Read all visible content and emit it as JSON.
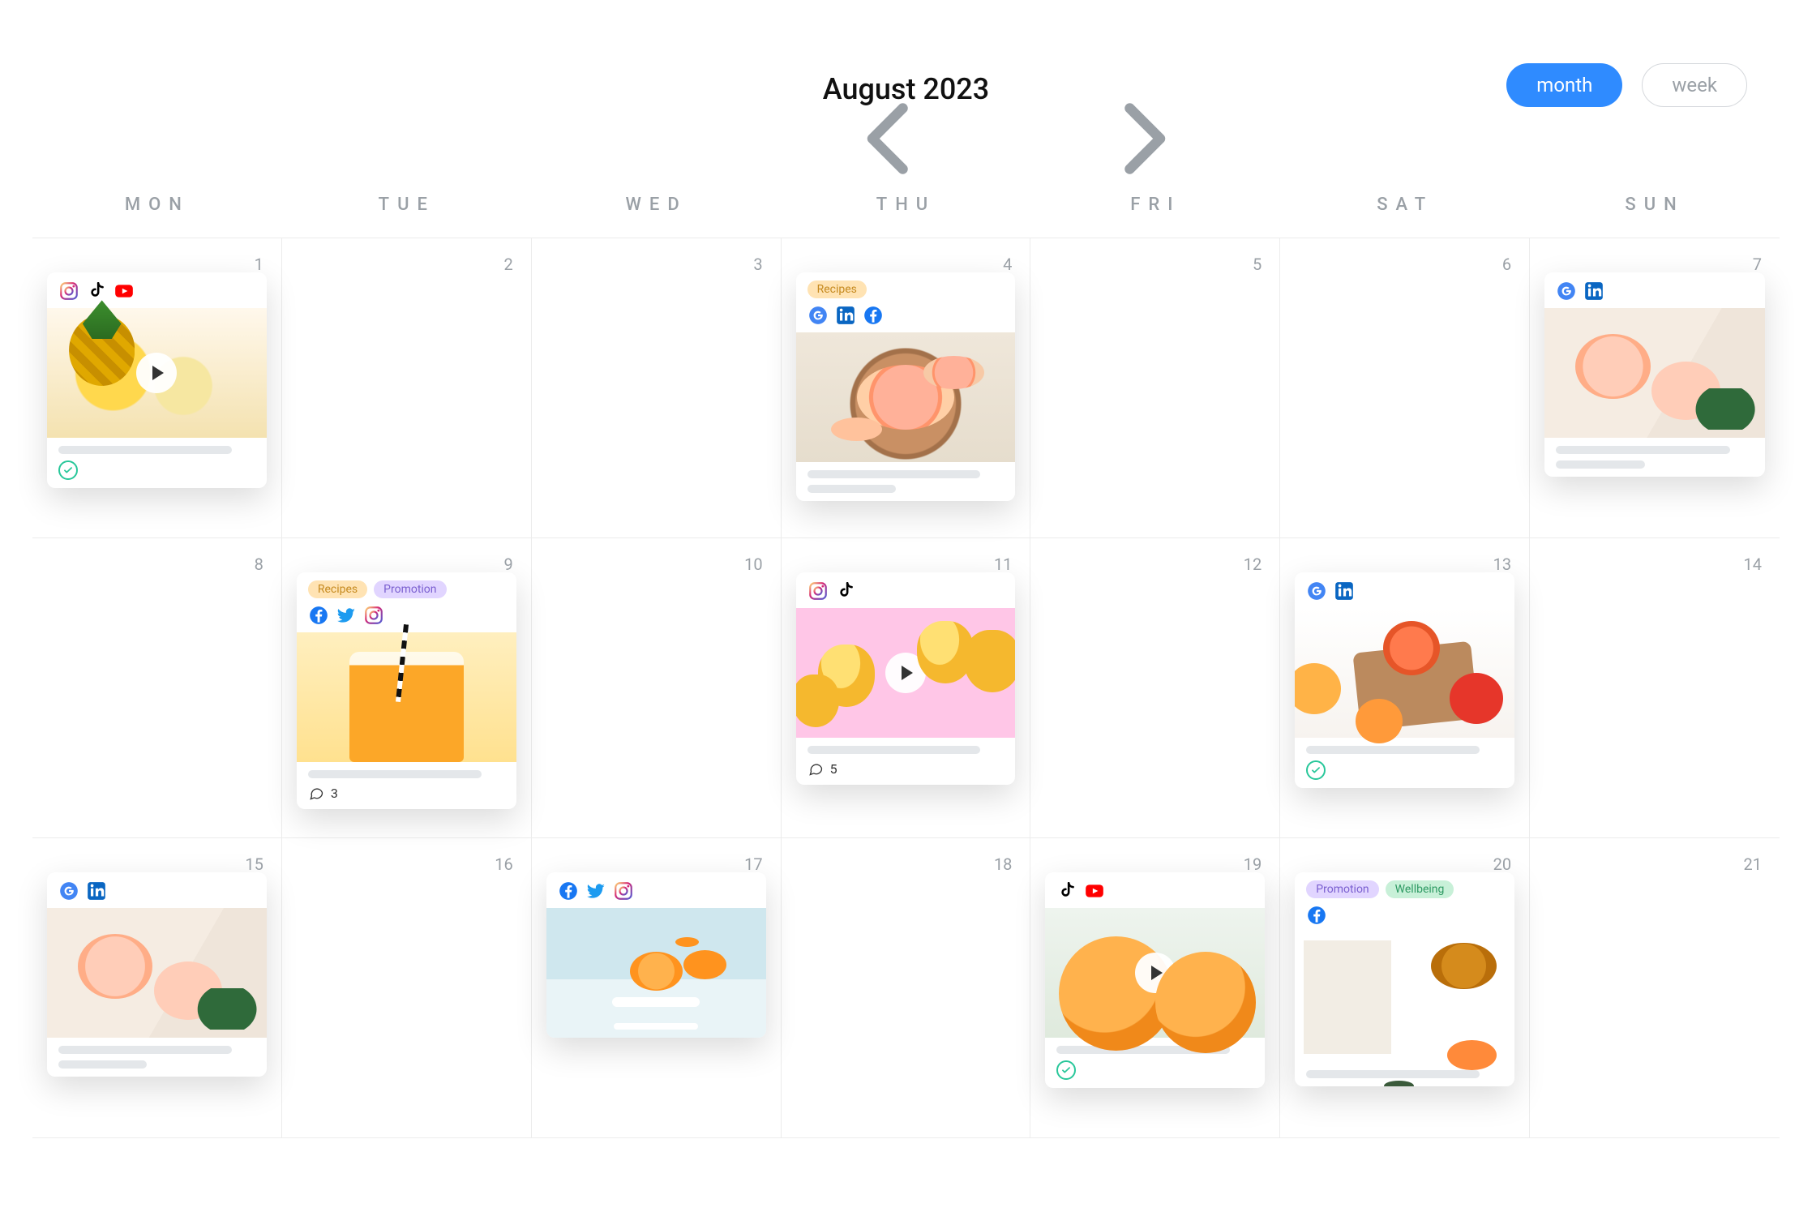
{
  "header": {
    "title": "August 2023",
    "prev_aria": "Previous month",
    "next_aria": "Next month"
  },
  "view_toggle": {
    "month": "month",
    "week": "week",
    "active": "month"
  },
  "weekdays": [
    "MON",
    "TUE",
    "WED",
    "THU",
    "FRI",
    "SAT",
    "SUN"
  ],
  "tag_labels": {
    "recipes": "Recipes",
    "promotion": "Promotion",
    "wellbeing": "Wellbeing"
  },
  "icon_names": {
    "instagram": "instagram-icon",
    "tiktok": "tiktok-icon",
    "youtube": "youtube-icon",
    "google": "google-icon",
    "linkedin": "linkedin-icon",
    "facebook": "facebook-icon",
    "twitter": "twitter-icon"
  },
  "days": [
    {
      "num": "1",
      "post": {
        "tags": [],
        "platforms": [
          "instagram",
          "tiktok",
          "youtube"
        ],
        "thumb": "pineapple",
        "has_play": true,
        "lines": [
          "long"
        ],
        "approved": true
      }
    },
    {
      "num": "2"
    },
    {
      "num": "3"
    },
    {
      "num": "4",
      "post": {
        "tags": [
          "recipes"
        ],
        "platforms": [
          "google",
          "linkedin",
          "facebook"
        ],
        "thumb": "grapefruit-wood",
        "lines": [
          "long",
          "short"
        ]
      }
    },
    {
      "num": "5"
    },
    {
      "num": "6"
    },
    {
      "num": "7",
      "post": {
        "tags": [],
        "platforms": [
          "google",
          "linkedin"
        ],
        "thumb": "cocktail-cloth",
        "lines": [
          "long",
          "short"
        ]
      }
    },
    {
      "num": "8"
    },
    {
      "num": "9",
      "post": {
        "tags": [
          "recipes",
          "promotion"
        ],
        "platforms": [
          "facebook",
          "twitter",
          "instagram"
        ],
        "thumb": "smoothie",
        "lines": [
          "long"
        ],
        "comments": "3"
      }
    },
    {
      "num": "10"
    },
    {
      "num": "11",
      "post": {
        "tags": [],
        "platforms": [
          "instagram",
          "tiktok"
        ],
        "thumb": "mango-pink",
        "has_play": true,
        "lines": [
          "long"
        ],
        "comments": "5"
      }
    },
    {
      "num": "12"
    },
    {
      "num": "13",
      "post": {
        "tags": [],
        "platforms": [
          "google",
          "linkedin"
        ],
        "thumb": "citrus-board",
        "lines": [
          "long"
        ],
        "approved": true
      }
    },
    {
      "num": "14"
    },
    {
      "num": "15",
      "post": {
        "tags": [],
        "platforms": [
          "google",
          "linkedin"
        ],
        "thumb": "cocktail-cloth",
        "lines": [
          "long",
          "short"
        ]
      }
    },
    {
      "num": "16"
    },
    {
      "num": "17",
      "post": {
        "tags": [],
        "platforms": [
          "facebook",
          "twitter",
          "instagram"
        ],
        "thumb": "orange-stand",
        "lines": []
      }
    },
    {
      "num": "18"
    },
    {
      "num": "19",
      "post": {
        "tags": [],
        "platforms": [
          "tiktok",
          "youtube"
        ],
        "thumb": "big-oranges",
        "has_play": true,
        "lines": [
          "long"
        ],
        "approved": true
      }
    },
    {
      "num": "20",
      "post": {
        "tags": [
          "promotion",
          "wellbeing"
        ],
        "platforms": [
          "facebook"
        ],
        "thumb": "magazine-tea",
        "lines": [
          "long"
        ]
      }
    },
    {
      "num": "21"
    }
  ]
}
